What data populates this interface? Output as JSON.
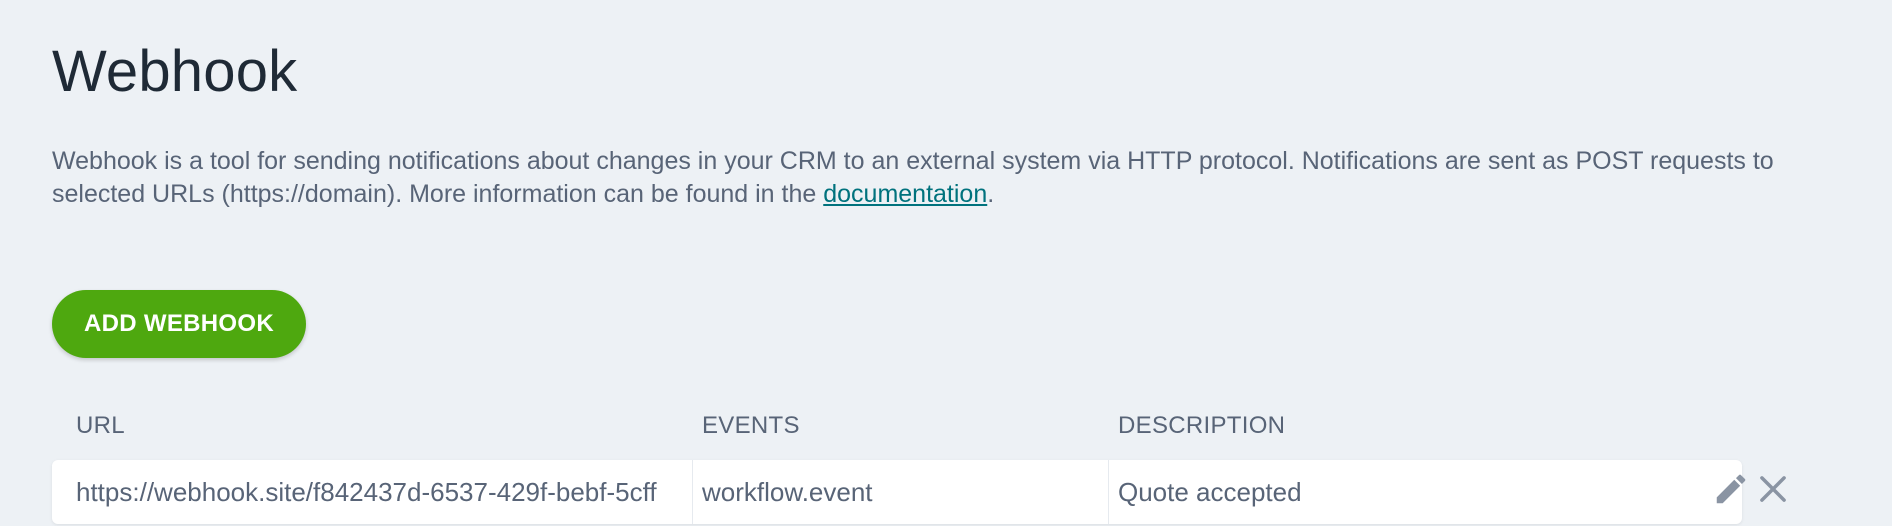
{
  "header": {
    "title": "Webhook"
  },
  "intro": {
    "text_before": "Webhook is a tool for sending notifications about changes in your CRM to an external system via HTTP protocol. Notifications are sent as POST requests to selected URLs (https://domain). More information can be found in the ",
    "link_label": "documentation",
    "text_after": "."
  },
  "toolbar": {
    "add_label": "ADD WEBHOOK"
  },
  "table": {
    "columns": {
      "url": "URL",
      "events": "EVENTS",
      "description": "DESCRIPTION"
    },
    "rows": [
      {
        "url": "https://webhook.site/f842437d-6537-429f-bebf-5cff",
        "events": "workflow.event",
        "description": "Quote accepted"
      }
    ]
  },
  "icons": {
    "edit": "pencil-icon",
    "delete": "close-icon"
  },
  "colors": {
    "background": "#edf1f5",
    "accent_button": "#4ea80f",
    "link": "#00727d",
    "title": "#1f2a36",
    "text": "#586477",
    "icon": "#8a94a3"
  }
}
